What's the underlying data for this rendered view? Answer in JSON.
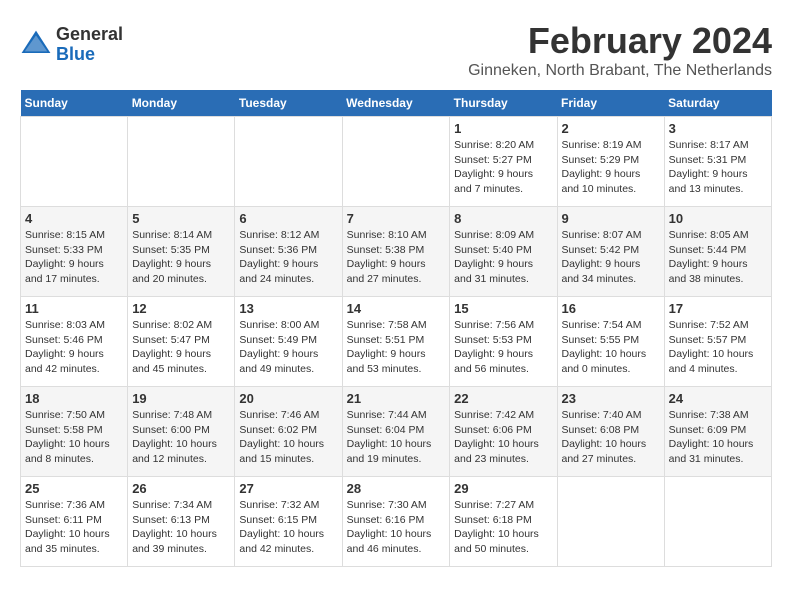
{
  "logo": {
    "general": "General",
    "blue": "Blue"
  },
  "title": "February 2024",
  "location": "Ginneken, North Brabant, The Netherlands",
  "days_of_week": [
    "Sunday",
    "Monday",
    "Tuesday",
    "Wednesday",
    "Thursday",
    "Friday",
    "Saturday"
  ],
  "weeks": [
    [
      {
        "day": "",
        "info": ""
      },
      {
        "day": "",
        "info": ""
      },
      {
        "day": "",
        "info": ""
      },
      {
        "day": "",
        "info": ""
      },
      {
        "day": "1",
        "info": "Sunrise: 8:20 AM\nSunset: 5:27 PM\nDaylight: 9 hours\nand 7 minutes."
      },
      {
        "day": "2",
        "info": "Sunrise: 8:19 AM\nSunset: 5:29 PM\nDaylight: 9 hours\nand 10 minutes."
      },
      {
        "day": "3",
        "info": "Sunrise: 8:17 AM\nSunset: 5:31 PM\nDaylight: 9 hours\nand 13 minutes."
      }
    ],
    [
      {
        "day": "4",
        "info": "Sunrise: 8:15 AM\nSunset: 5:33 PM\nDaylight: 9 hours\nand 17 minutes."
      },
      {
        "day": "5",
        "info": "Sunrise: 8:14 AM\nSunset: 5:35 PM\nDaylight: 9 hours\nand 20 minutes."
      },
      {
        "day": "6",
        "info": "Sunrise: 8:12 AM\nSunset: 5:36 PM\nDaylight: 9 hours\nand 24 minutes."
      },
      {
        "day": "7",
        "info": "Sunrise: 8:10 AM\nSunset: 5:38 PM\nDaylight: 9 hours\nand 27 minutes."
      },
      {
        "day": "8",
        "info": "Sunrise: 8:09 AM\nSunset: 5:40 PM\nDaylight: 9 hours\nand 31 minutes."
      },
      {
        "day": "9",
        "info": "Sunrise: 8:07 AM\nSunset: 5:42 PM\nDaylight: 9 hours\nand 34 minutes."
      },
      {
        "day": "10",
        "info": "Sunrise: 8:05 AM\nSunset: 5:44 PM\nDaylight: 9 hours\nand 38 minutes."
      }
    ],
    [
      {
        "day": "11",
        "info": "Sunrise: 8:03 AM\nSunset: 5:46 PM\nDaylight: 9 hours\nand 42 minutes."
      },
      {
        "day": "12",
        "info": "Sunrise: 8:02 AM\nSunset: 5:47 PM\nDaylight: 9 hours\nand 45 minutes."
      },
      {
        "day": "13",
        "info": "Sunrise: 8:00 AM\nSunset: 5:49 PM\nDaylight: 9 hours\nand 49 minutes."
      },
      {
        "day": "14",
        "info": "Sunrise: 7:58 AM\nSunset: 5:51 PM\nDaylight: 9 hours\nand 53 minutes."
      },
      {
        "day": "15",
        "info": "Sunrise: 7:56 AM\nSunset: 5:53 PM\nDaylight: 9 hours\nand 56 minutes."
      },
      {
        "day": "16",
        "info": "Sunrise: 7:54 AM\nSunset: 5:55 PM\nDaylight: 10 hours\nand 0 minutes."
      },
      {
        "day": "17",
        "info": "Sunrise: 7:52 AM\nSunset: 5:57 PM\nDaylight: 10 hours\nand 4 minutes."
      }
    ],
    [
      {
        "day": "18",
        "info": "Sunrise: 7:50 AM\nSunset: 5:58 PM\nDaylight: 10 hours\nand 8 minutes."
      },
      {
        "day": "19",
        "info": "Sunrise: 7:48 AM\nSunset: 6:00 PM\nDaylight: 10 hours\nand 12 minutes."
      },
      {
        "day": "20",
        "info": "Sunrise: 7:46 AM\nSunset: 6:02 PM\nDaylight: 10 hours\nand 15 minutes."
      },
      {
        "day": "21",
        "info": "Sunrise: 7:44 AM\nSunset: 6:04 PM\nDaylight: 10 hours\nand 19 minutes."
      },
      {
        "day": "22",
        "info": "Sunrise: 7:42 AM\nSunset: 6:06 PM\nDaylight: 10 hours\nand 23 minutes."
      },
      {
        "day": "23",
        "info": "Sunrise: 7:40 AM\nSunset: 6:08 PM\nDaylight: 10 hours\nand 27 minutes."
      },
      {
        "day": "24",
        "info": "Sunrise: 7:38 AM\nSunset: 6:09 PM\nDaylight: 10 hours\nand 31 minutes."
      }
    ],
    [
      {
        "day": "25",
        "info": "Sunrise: 7:36 AM\nSunset: 6:11 PM\nDaylight: 10 hours\nand 35 minutes."
      },
      {
        "day": "26",
        "info": "Sunrise: 7:34 AM\nSunset: 6:13 PM\nDaylight: 10 hours\nand 39 minutes."
      },
      {
        "day": "27",
        "info": "Sunrise: 7:32 AM\nSunset: 6:15 PM\nDaylight: 10 hours\nand 42 minutes."
      },
      {
        "day": "28",
        "info": "Sunrise: 7:30 AM\nSunset: 6:16 PM\nDaylight: 10 hours\nand 46 minutes."
      },
      {
        "day": "29",
        "info": "Sunrise: 7:27 AM\nSunset: 6:18 PM\nDaylight: 10 hours\nand 50 minutes."
      },
      {
        "day": "",
        "info": ""
      },
      {
        "day": "",
        "info": ""
      }
    ]
  ]
}
